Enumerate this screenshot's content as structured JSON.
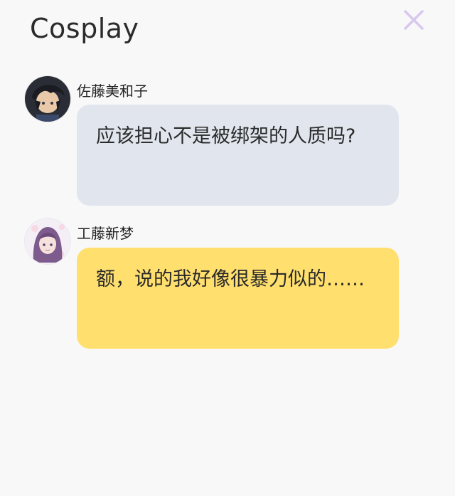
{
  "header": {
    "title": "Cosplay"
  },
  "messages": [
    {
      "sender": "佐藤美和子",
      "text": "应该担心不是被绑架的人质吗?",
      "bubble_color": "#e1e6ee",
      "avatar_icon": "dark-haired-character-avatar-icon"
    },
    {
      "sender": "工藤新梦",
      "text": "额，说的我好像很暴力似的……",
      "bubble_color": "#ffdf6d",
      "avatar_icon": "purple-haired-character-avatar-icon"
    }
  ],
  "colors": {
    "background": "#f8f8f9",
    "close_icon": "#d9c8ee",
    "title_text": "#2b2b2b"
  }
}
